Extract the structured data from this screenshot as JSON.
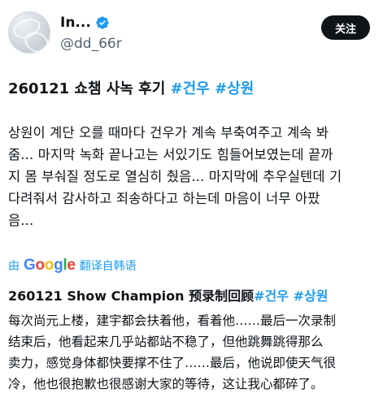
{
  "profile": {
    "display_name": "In...",
    "handle": "@dd_66r",
    "follow_label": "关注"
  },
  "post": {
    "title_prefix": "260121 쇼챔 사녹 후기",
    "hashtags": [
      "#건우",
      "#상원"
    ],
    "body_lines": [
      "상원이 계단 오를 때마다 건우가 계속 부축여주고 계속 봐",
      "줌... 마지막 녹화 끝나고는 서있기도 힘들어보였는데 끝까",
      "지 몸 부숴질 정도로 열심히 췄음... 마지막에 추우실텐데 기",
      "다려줘서 감사하고 죄송하다고 하는데 마음이 너무 아팠",
      "음..."
    ]
  },
  "translation": {
    "by_label": "由",
    "google_letters": [
      "G",
      "o",
      "o",
      "g",
      "l",
      "e"
    ],
    "google_colors": [
      "#4285F4",
      "#EA4335",
      "#FBBC05",
      "#4285F4",
      "#34A853",
      "#EA4335"
    ],
    "translate_label": "翻译自韩语",
    "title_prefix": "260121 Show Champion 预录制回顾",
    "hashtags": [
      "#건우",
      "#상원"
    ],
    "body_lines": [
      "每次尚元上楼，建宇都会扶着他，看着他……最后一次录制",
      "结束后，他看起来几乎站都站不稳了，但他跳舞跳得那么",
      "卖力，感觉身体都快要撑不住了……最后，他说即使天气很",
      "冷，他也很抱歉也很感谢大家的等待，这让我心都碎了。"
    ]
  },
  "colors": {
    "accent": "#1d9bf0",
    "text": "#0f1419",
    "muted": "#536471",
    "button_bg": "#0f1419"
  }
}
